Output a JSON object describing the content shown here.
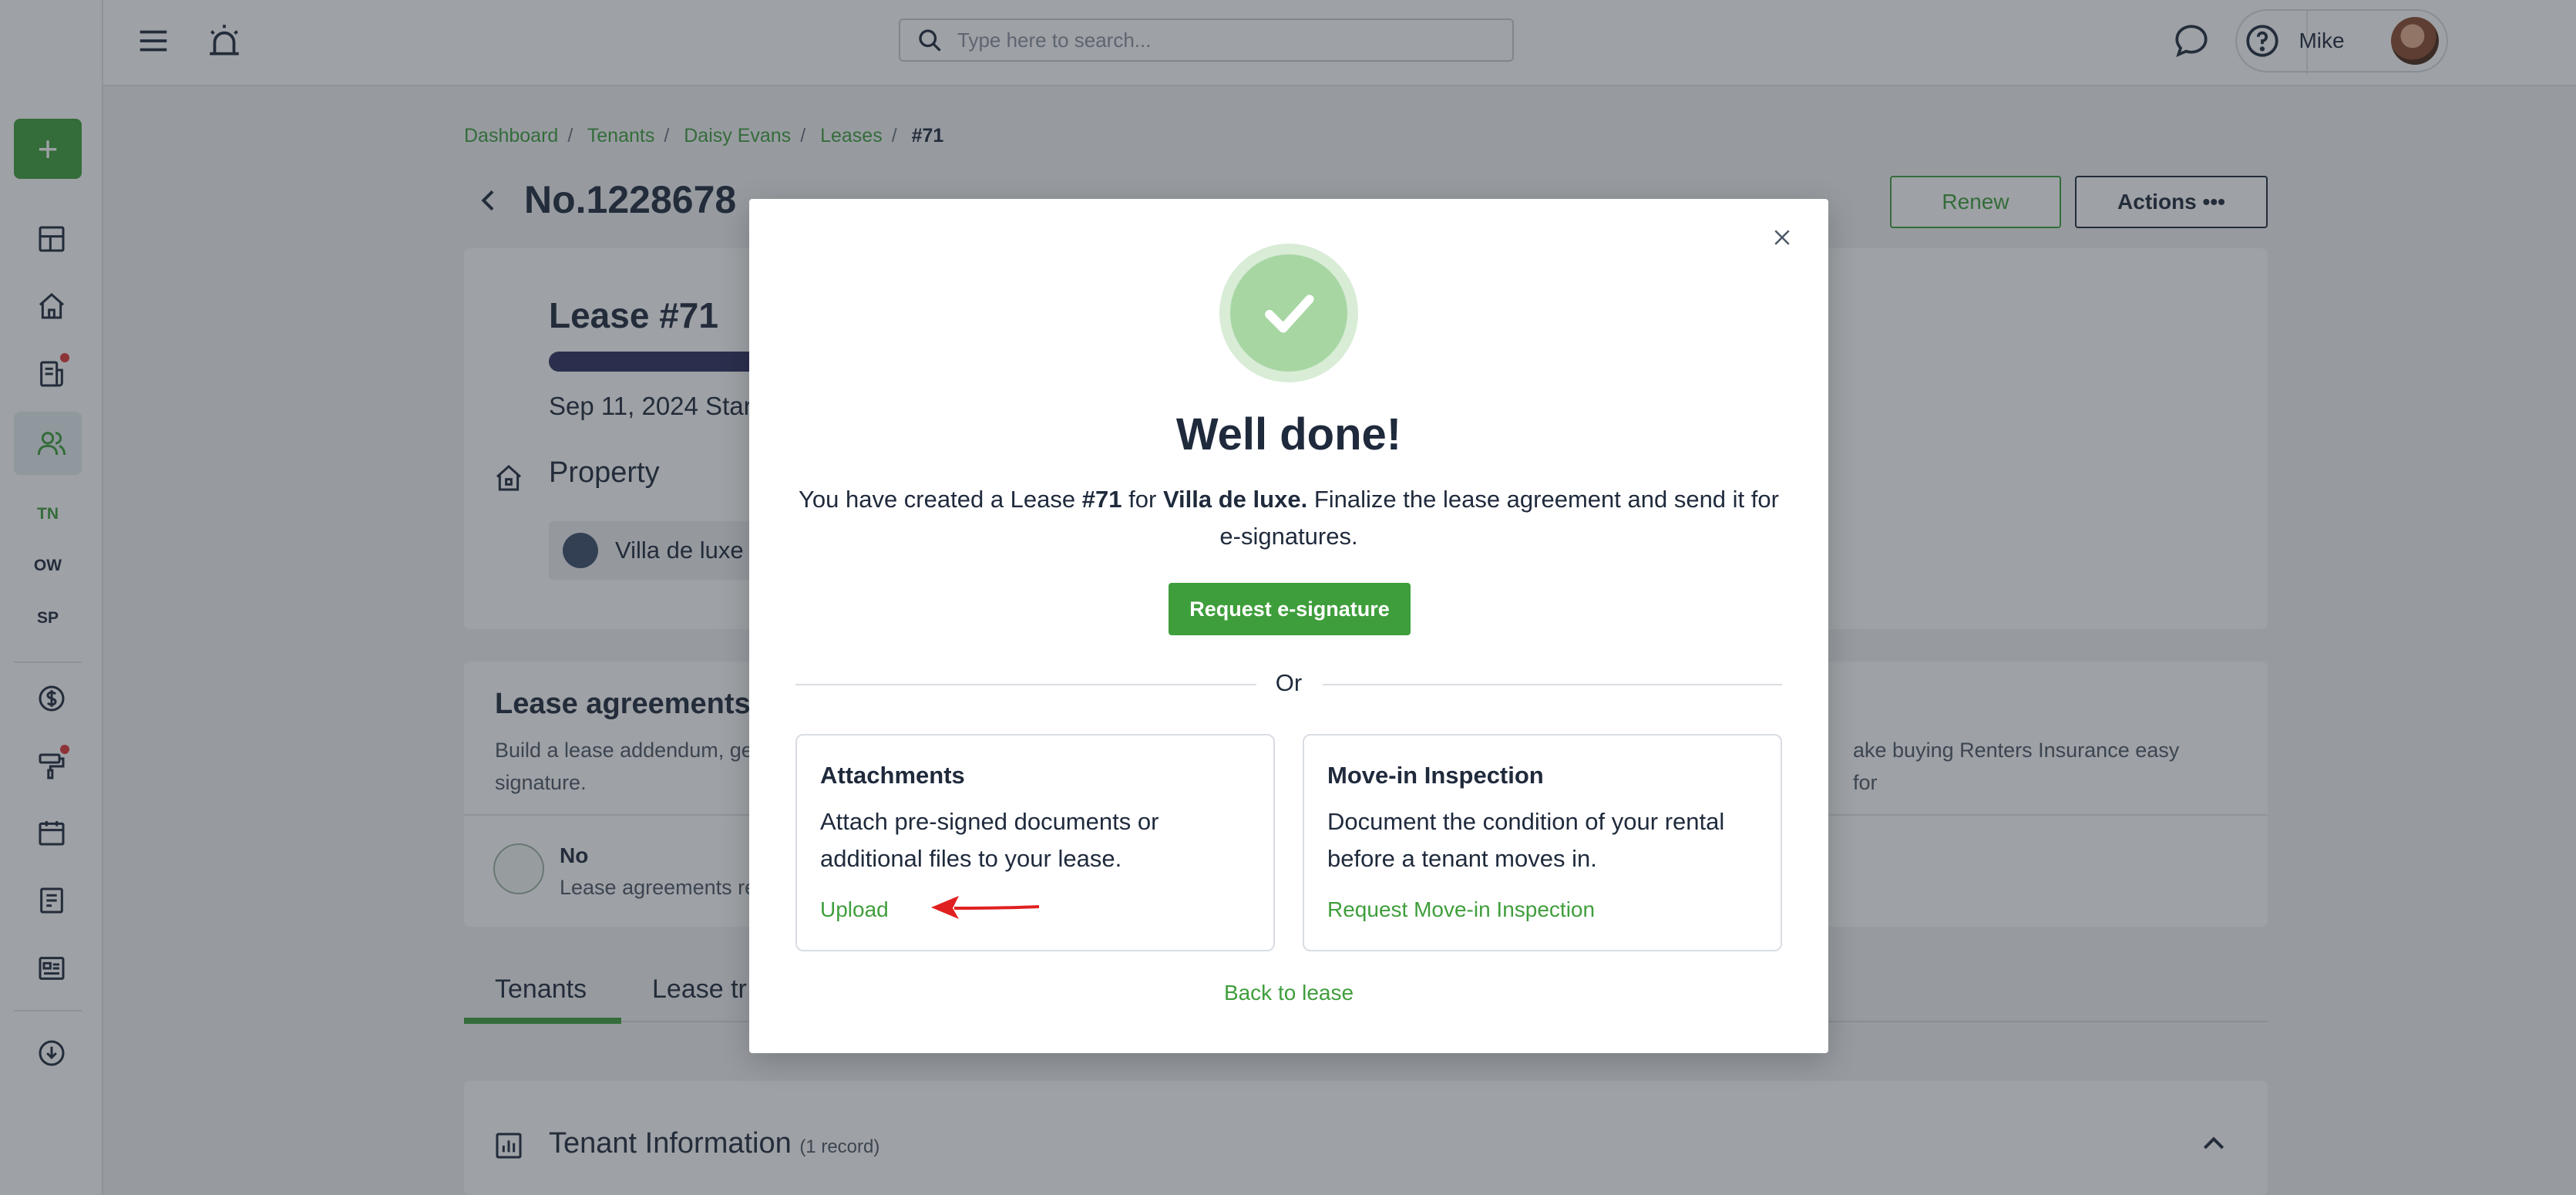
{
  "topbar": {
    "search_placeholder": "Type here to search...",
    "user_name": "Mike"
  },
  "sidebar": {
    "add_label": "+",
    "abbreviations": [
      "TN",
      "OW",
      "SP"
    ]
  },
  "breadcrumb": [
    "Dashboard",
    "Tenants",
    "Daisy Evans",
    "Leases",
    "#71"
  ],
  "breadcrumb_separator": "/",
  "page": {
    "title": "No.1228678",
    "renew_label": "Renew",
    "actions_label": "Actions",
    "lease_title": "Lease #71",
    "lease_date": "Sep 11, 2024 Star",
    "property_heading": "Property",
    "property_name": "Villa de luxe",
    "agreements_title": "Lease agreements",
    "agreements_desc_left": "Build a lease addendum, ge",
    "agreements_desc_right": "ake buying Renters Insurance easy for",
    "agreements_desc_line2": "signature.",
    "agreements_status": "No",
    "agreements_sub": "Lease agreements re",
    "tabs": [
      "Tenants",
      "Lease tr"
    ],
    "tenant_info_title": "Tenant Information",
    "tenant_info_count": "(1 record)"
  },
  "modal": {
    "title": "Well done!",
    "msg_prefix": "You have created a Lease",
    "msg_lease": "#71",
    "msg_for": "for",
    "msg_property": "Villa de luxe.",
    "msg_suffix": "Finalize the lease agreement and send it for e-signatures.",
    "esign_button": "Request e-signature",
    "or_text": "Or",
    "attachments": {
      "title": "Attachments",
      "desc": "Attach pre-signed documents or additional files to your lease.",
      "link": "Upload"
    },
    "inspection": {
      "title": "Move-in Inspection",
      "desc": "Document the condition of your rental before a tenant moves in.",
      "link": "Request Move-in Inspection"
    },
    "back_link": "Back to lease"
  },
  "colors": {
    "accent_green": "#3f9e3c",
    "text_dark": "#1f2a3c",
    "annotation_arrow": "#e02020"
  }
}
